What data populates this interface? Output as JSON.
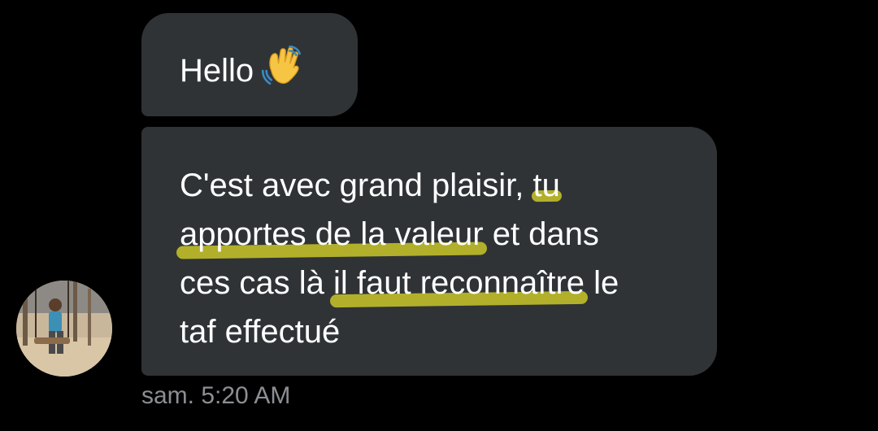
{
  "conversation": {
    "messages": [
      {
        "text": "Hello",
        "emoji": "waving-hand"
      },
      {
        "lines": [
          {
            "before": "C'est avec grand plaisir, ",
            "highlight": "tu",
            "after": ""
          },
          {
            "before": "",
            "highlight": "apportes de la valeur",
            "after": " et dans"
          },
          {
            "before": "ces cas là ",
            "highlight": "il faut reconnaître",
            "after": " le"
          },
          {
            "before": "taf effectué",
            "highlight": "",
            "after": ""
          }
        ]
      }
    ],
    "timestamp": "sam. 5:20 AM",
    "colors": {
      "background": "#000000",
      "bubble": "#2f3336",
      "highlight": "#d7d428",
      "timestamp": "#8b8f94"
    }
  }
}
